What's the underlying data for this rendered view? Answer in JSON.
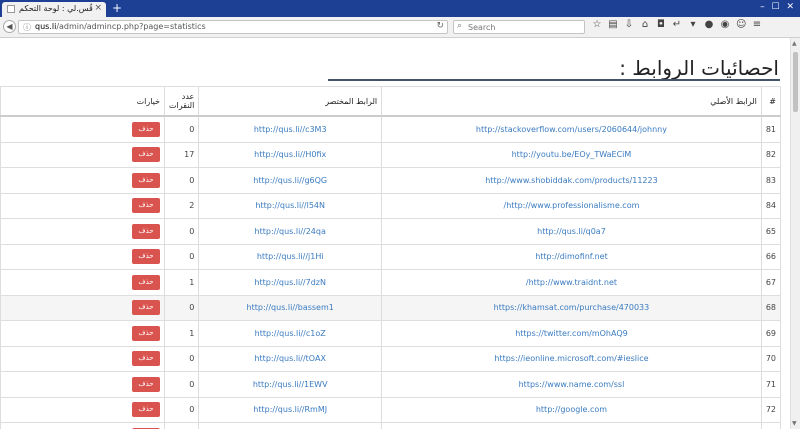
{
  "browser": {
    "tab_title": "قُس.لي : لوحة التحكم",
    "tab_close": "×",
    "new_tab": "+",
    "window_controls": "– ☐ ✕",
    "url_domain": "qus.li",
    "url_path": "/admin/admincp.php?page=statistics",
    "search_placeholder": "Search",
    "icons": [
      "star-icon",
      "clipboard-icon",
      "download-icon",
      "home-icon",
      "pocket-icon",
      "reply-icon",
      "bookmark-icon",
      "chat-icon",
      "chat-icon-2",
      "smiley-icon",
      "menu-icon"
    ]
  },
  "page": {
    "title": "احصائيات الروابط :",
    "headers": {
      "index": "#",
      "original": "الرابط الأصلي",
      "short": "الرابط المختصر",
      "clicks": "عدد النقرات",
      "options": "خيارات"
    },
    "delete_label": "حذف",
    "rows": [
      {
        "id": "81",
        "original": "http://stackoverflow.com/users/2060644/johnny",
        "short": "http://qus.li//c3M3",
        "clicks": "0",
        "shaded": false
      },
      {
        "id": "82",
        "original": "http://youtu.be/EOy_TWaECiM",
        "short": "http://qus.li//H0fix",
        "clicks": "17",
        "shaded": false
      },
      {
        "id": "83",
        "original": "http://www.shobiddak.com/products/11223",
        "short": "http://qus.li//g6QG",
        "clicks": "0",
        "shaded": false
      },
      {
        "id": "84",
        "original": "http://www.professionalisme.com/",
        "short": "http://qus.li//l54N",
        "clicks": "2",
        "shaded": false
      },
      {
        "id": "65",
        "original": "http://qus.li/q0a7",
        "short": "http://qus.li//24qa",
        "clicks": "0",
        "shaded": false
      },
      {
        "id": "66",
        "original": "http://dimofinf.net",
        "short": "http://qus.li//j1Hi",
        "clicks": "0",
        "shaded": false
      },
      {
        "id": "67",
        "original": "http://www.traidnt.net/",
        "short": "http://qus.li//7dzN",
        "clicks": "1",
        "shaded": false
      },
      {
        "id": "68",
        "original": "https://khamsat.com/purchase/470033",
        "short": "http://qus.li//bassem1",
        "clicks": "0",
        "shaded": true
      },
      {
        "id": "69",
        "original": "https://twitter.com/mOhAQ9",
        "short": "http://qus.li//c1oZ",
        "clicks": "1",
        "shaded": false
      },
      {
        "id": "70",
        "original": "https://ieonline.microsoft.com/#ieslice",
        "short": "http://qus.li//tOAX",
        "clicks": "0",
        "shaded": false
      },
      {
        "id": "71",
        "original": "https://www.name.com/ssl",
        "short": "http://qus.li//1EWV",
        "clicks": "0",
        "shaded": false
      },
      {
        "id": "72",
        "original": "http://google.com",
        "short": "http://qus.li//RmMJ",
        "clicks": "0",
        "shaded": false
      },
      {
        "id": "73",
        "original": "",
        "short": "",
        "clicks": "",
        "shaded": false
      }
    ]
  }
}
